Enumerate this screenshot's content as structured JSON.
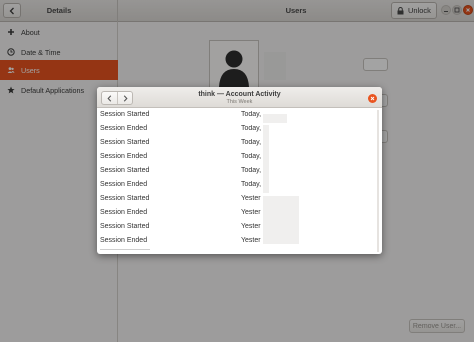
{
  "window": {
    "left_title": "Details",
    "center_title": "Users",
    "unlock_label": "Unlock"
  },
  "sidebar": {
    "items": [
      {
        "label": "About",
        "icon": "plus-icon"
      },
      {
        "label": "Date & Time",
        "icon": "clock-icon"
      },
      {
        "label": "Users",
        "icon": "users-icon",
        "active": true
      },
      {
        "label": "Default Applications",
        "icon": "star-icon"
      }
    ]
  },
  "content": {
    "remove_user_label": "Remove User..."
  },
  "dialog": {
    "title": "think — Account Activity",
    "subtitle": "This Week",
    "rows": [
      {
        "event": "Session Started",
        "when": "Today,"
      },
      {
        "event": "Session Ended",
        "when": "Today,"
      },
      {
        "event": "Session Started",
        "when": "Today,"
      },
      {
        "event": "Session Ended",
        "when": "Today,"
      },
      {
        "event": "Session Started",
        "when": "Today,"
      },
      {
        "event": "Session Ended",
        "when": "Today,"
      },
      {
        "event": "Session Started",
        "when": "Yester"
      },
      {
        "event": "Session Ended",
        "when": "Yester"
      },
      {
        "event": "Session Started",
        "when": "Yester"
      },
      {
        "event": "Session Ended",
        "when": "Yester"
      }
    ]
  },
  "colors": {
    "accent": "#e95420",
    "background": "#f6f5f4"
  }
}
